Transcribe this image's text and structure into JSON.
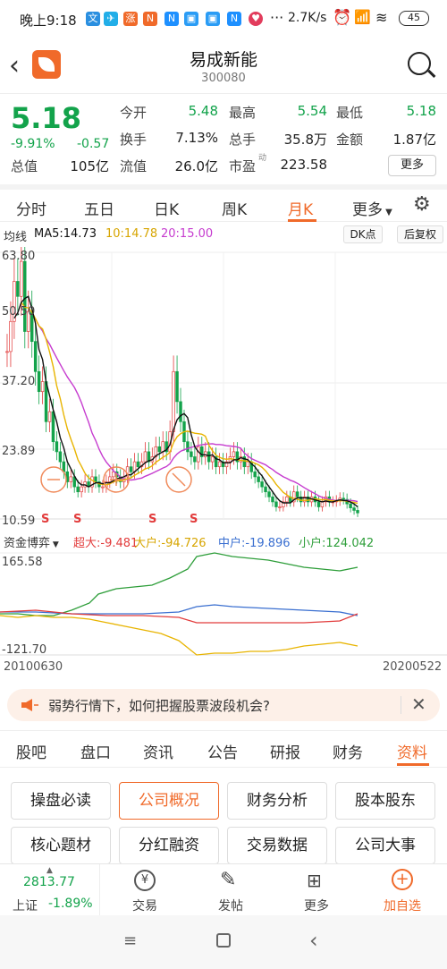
{
  "status_bar": {
    "time": "晚上9:18",
    "net_speed": "2.7K/s",
    "battery": "45"
  },
  "header": {
    "stock_name": "易成新能",
    "stock_code": "300080"
  },
  "quote": {
    "price": "5.18",
    "change_pct": "-9.91%",
    "change": "-0.57",
    "open_label": "今开",
    "open": "5.48",
    "high_label": "最高",
    "high": "5.54",
    "low_label": "最低",
    "low": "5.18",
    "turnover_label": "换手",
    "turnover": "7.13%",
    "volume_label": "总手",
    "volume": "35.8万",
    "amount_label": "金额",
    "amount": "1.87亿",
    "mktcap_label": "总值",
    "mktcap": "105亿",
    "float_label": "流值",
    "float": "26.0亿",
    "pe_label": "市盈",
    "pe_sup": "动",
    "pe": "223.58",
    "more_label": "更多"
  },
  "tabs": [
    "分时",
    "五日",
    "日K",
    "周K",
    "月K",
    "更多"
  ],
  "active_tab": 4,
  "legend": {
    "ma_label": "均线",
    "ma5": "MA5:14.73",
    "ma10": "10:14.78",
    "ma20": "20:15.00",
    "dk_btn": "DK点",
    "fq_btn": "后复权"
  },
  "colors": {
    "up": "#e23c3c",
    "down": "#13a34b",
    "accent": "#f06a2a",
    "ma5": "#111111",
    "ma10": "#e8b400",
    "ma20": "#c63ccf",
    "main_flow": "#e23c3c",
    "large": "#e8b400",
    "medium": "#3a6fd0",
    "small": "#2e9e3a"
  },
  "chart_data": [
    {
      "type": "candlestick",
      "title": "月K",
      "y_ticks": [
        "63.80",
        "50.50",
        "37.20",
        "23.89",
        "10.59"
      ],
      "ylim": [
        10.59,
        63.8
      ],
      "ma": {
        "MA5": 14.73,
        "MA10": 14.78,
        "MA20": 15.0
      },
      "close": [
        44,
        50,
        58,
        55,
        62,
        48,
        52,
        46,
        40,
        36,
        38,
        30,
        32,
        26,
        24,
        22,
        20,
        18,
        19,
        17,
        16,
        17,
        18,
        17,
        19,
        18,
        17,
        17,
        18,
        19,
        20,
        19,
        18,
        19,
        21,
        20,
        22,
        21,
        22,
        24,
        22,
        23,
        25,
        24,
        26,
        24,
        28,
        40,
        34,
        30,
        26,
        24,
        23,
        22,
        25,
        23,
        24,
        22,
        23,
        21,
        22,
        21,
        22,
        23,
        24,
        22,
        23,
        21,
        22,
        20,
        19,
        18,
        17,
        16,
        15,
        14,
        13,
        13,
        14,
        15,
        14,
        16,
        15,
        14,
        15,
        14,
        15,
        14,
        13,
        14,
        15,
        14,
        14,
        14.2,
        14.73,
        14.5,
        13.6,
        12.8,
        12.3,
        11.8
      ],
      "annotations": [
        "S",
        "S",
        "S",
        "S"
      ]
    },
    {
      "type": "line",
      "title": "资金博弈",
      "y_ticks": [
        "165.58",
        "-121.70"
      ],
      "ylim": [
        -121.7,
        165.58
      ],
      "series": [
        {
          "name": "超大",
          "last": "-9.481"
        },
        {
          "name": "大户",
          "last": "-94.726"
        },
        {
          "name": "中户",
          "last": "-19.896"
        },
        {
          "name": "小户",
          "last": "124.042"
        }
      ],
      "x_labels": [
        "20100630",
        "20200522"
      ]
    }
  ],
  "flow": {
    "title": "资金博弈",
    "super": "超大:-9.481",
    "large": "大户:-94.726",
    "medium": "中户:-19.896",
    "small": "小户:124.042",
    "date_start": "20100630",
    "date_end": "20200522"
  },
  "banner": {
    "text": "弱势行情下，如何把握股票波段机会?"
  },
  "subtabs": [
    "股吧",
    "盘口",
    "资讯",
    "公告",
    "研报",
    "财务",
    "资料"
  ],
  "active_subtab": 6,
  "grid_buttons": [
    "操盘必读",
    "公司概况",
    "财务分析",
    "股本股东",
    "核心题材",
    "分红融资",
    "交易数据",
    "公司大事"
  ],
  "bottom_bar": {
    "index_value": "2813.77",
    "index_name": "上证",
    "index_change": "-1.89%",
    "items": [
      "交易",
      "发帖",
      "更多",
      "加自选"
    ]
  }
}
